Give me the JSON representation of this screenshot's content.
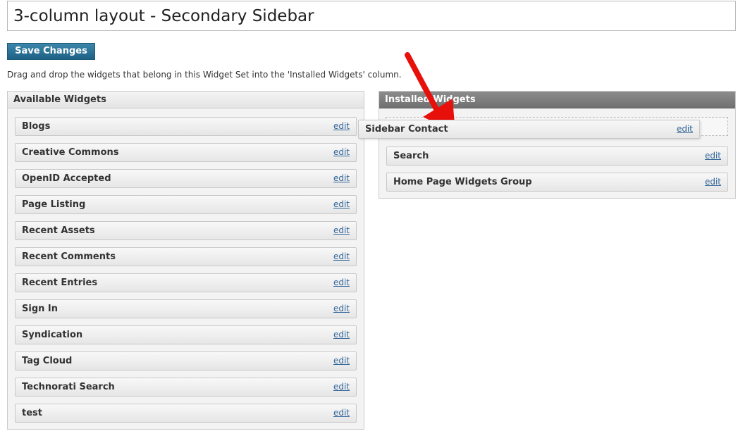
{
  "widget_set": {
    "name": "3-column layout - Secondary Sidebar"
  },
  "toolbar": {
    "save_label": "Save Changes"
  },
  "instructions": "Drag and drop the widgets that belong in this Widget Set into the 'Installed Widgets' column.",
  "available": {
    "title": "Available Widgets",
    "edit_label": "edit",
    "items": [
      {
        "label": "Blogs"
      },
      {
        "label": "Creative Commons"
      },
      {
        "label": "OpenID Accepted"
      },
      {
        "label": "Page Listing"
      },
      {
        "label": "Recent Assets"
      },
      {
        "label": "Recent Comments"
      },
      {
        "label": "Recent Entries"
      },
      {
        "label": "Sign In"
      },
      {
        "label": "Syndication"
      },
      {
        "label": "Tag Cloud"
      },
      {
        "label": "Technorati Search"
      },
      {
        "label": "test"
      }
    ]
  },
  "installed": {
    "title": "Installed Widgets",
    "edit_label": "edit",
    "items": [
      {
        "label": "Search"
      },
      {
        "label": "Home Page Widgets Group"
      }
    ]
  },
  "dragging": {
    "label": "Sidebar Contact",
    "edit_label": "edit"
  },
  "colors": {
    "primary_button": "#1d6285",
    "link": "#336699",
    "arrow": "#e8100b",
    "installed_header": "#7a7a7a"
  },
  "icons": {
    "annotation": "red-arrow-icon"
  }
}
